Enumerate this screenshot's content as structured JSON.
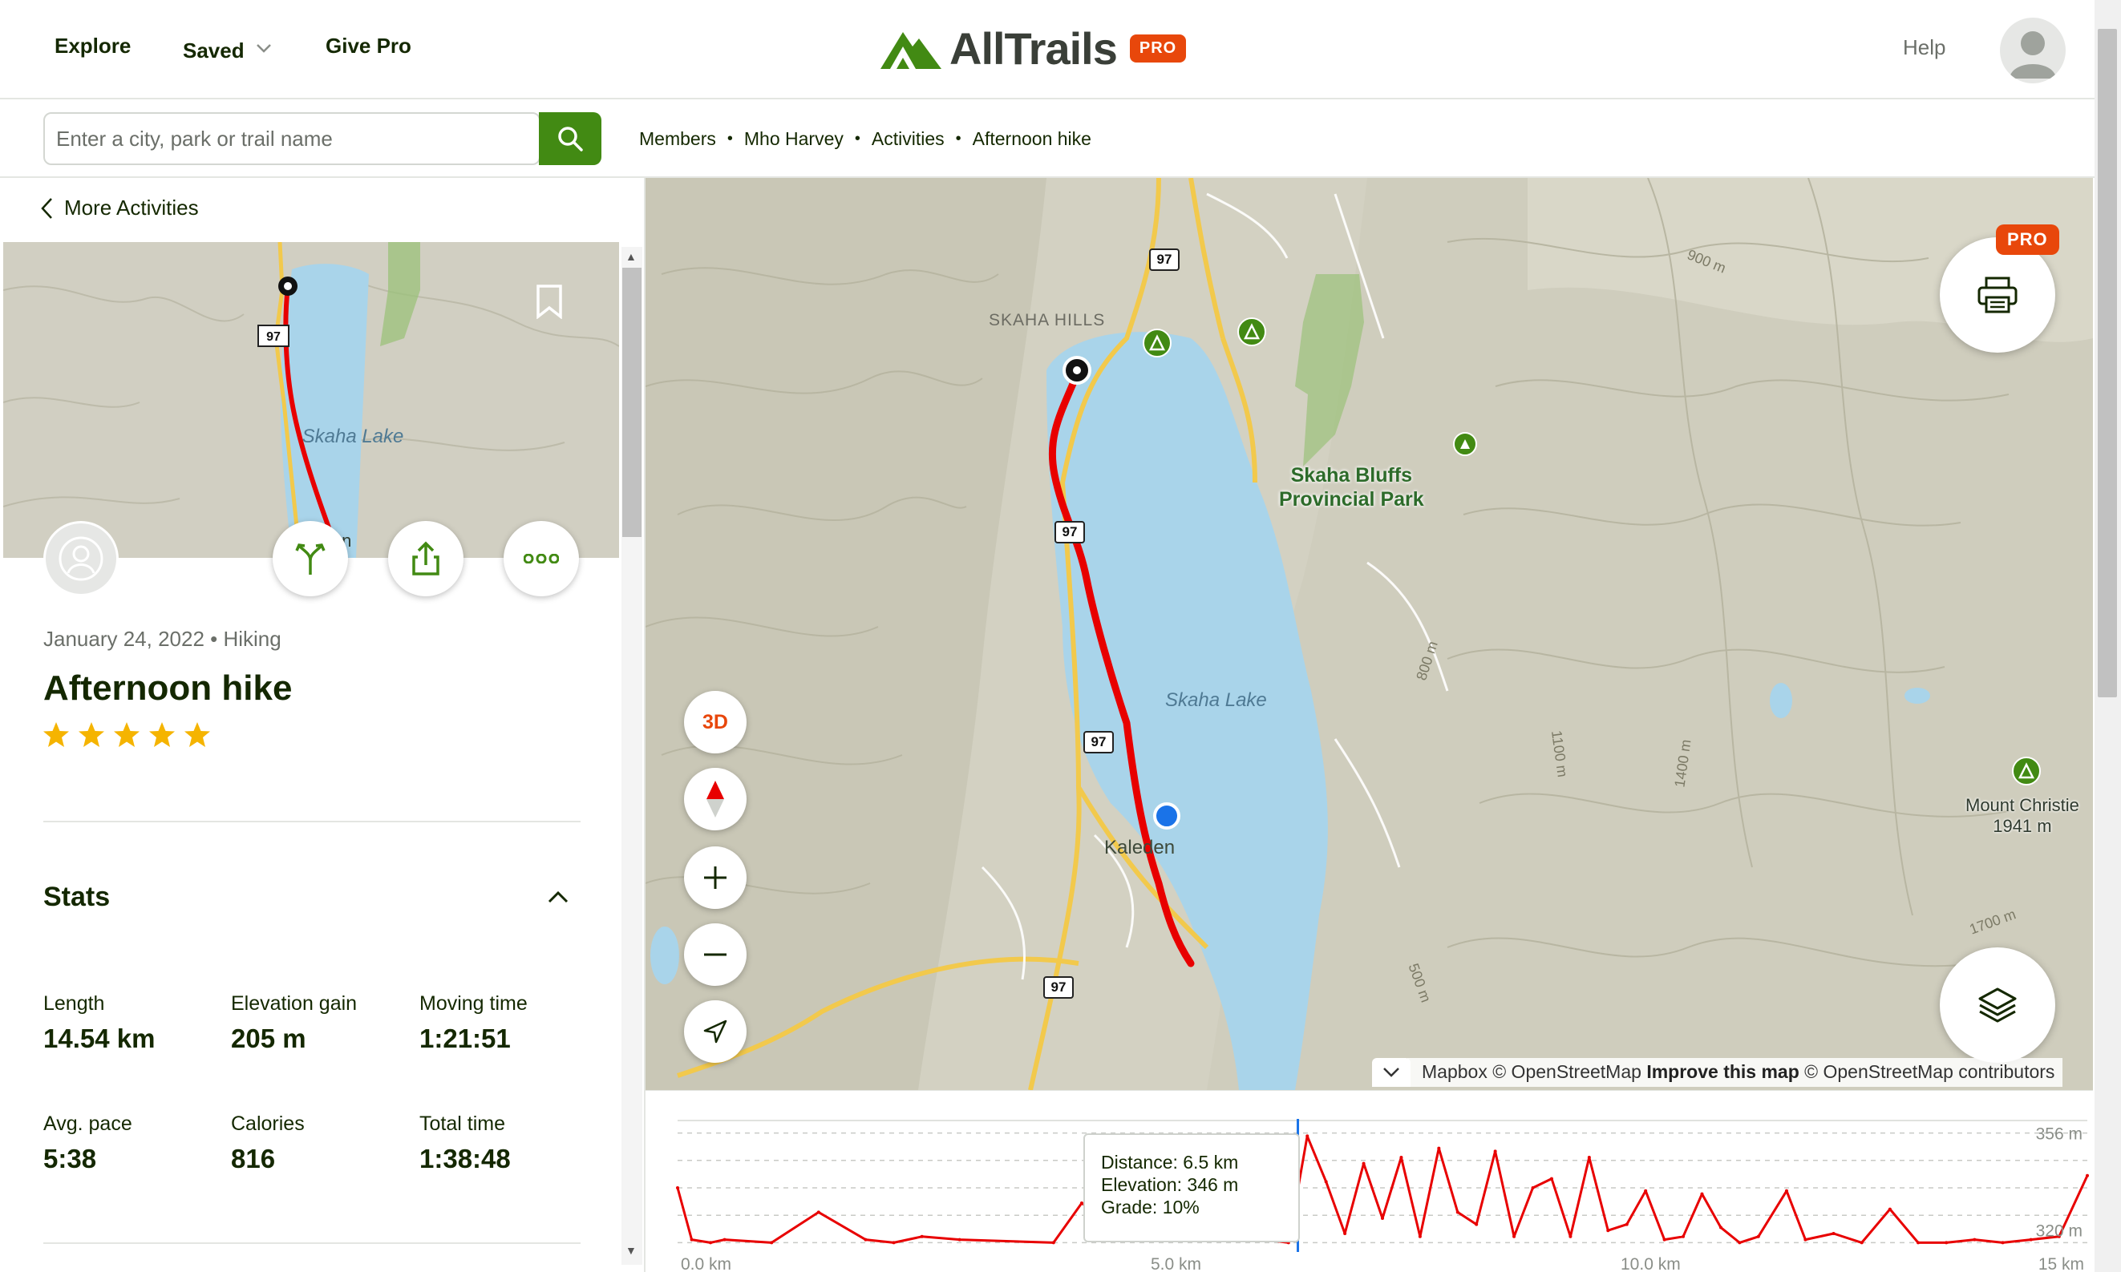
{
  "header": {
    "nav": [
      "Explore",
      "Saved",
      "Give Pro"
    ],
    "logo_text": "AllTrails",
    "logo_badge": "PRO",
    "help": "Help"
  },
  "search": {
    "placeholder": "Enter a city, park or trail name",
    "value": ""
  },
  "breadcrumbs": [
    "Members",
    "Mho Harvey",
    "Activities",
    "Afternoon hike"
  ],
  "sidebar": {
    "back_label": "More Activities",
    "thumbnail": {
      "lake_label": "Skaha Lake",
      "town_label": "Kaleden",
      "highway": "97"
    },
    "meta": "January 24, 2022 • Hiking",
    "title": "Afternoon hike",
    "rating": 5,
    "stats_heading": "Stats",
    "stats": [
      {
        "label": "Length",
        "value": "14.54 km"
      },
      {
        "label": "Elevation gain",
        "value": "205 m"
      },
      {
        "label": "Moving time",
        "value": "1:21:51"
      },
      {
        "label": "Avg. pace",
        "value": "5:38"
      },
      {
        "label": "Calories",
        "value": "816"
      },
      {
        "label": "Total time",
        "value": "1:38:48"
      }
    ]
  },
  "map": {
    "labels": {
      "skaha_hills": "SKAHA HILLS",
      "lake": "Skaha Lake",
      "town": "Kaleden",
      "park_line1": "Skaha Bluffs",
      "park_line2": "Provincial Park",
      "peak_name": "Mount Christie",
      "peak_elev": "1941 m",
      "contours": [
        "900 m",
        "800 m",
        "1100 m",
        "1400 m",
        "500 m",
        "1700 m"
      ],
      "highway": "97"
    },
    "controls": {
      "three_d": "3D",
      "pro_badge": "PRO"
    },
    "attribution": {
      "mapbox": "Mapbox © OpenStreetMap",
      "improve": "Improve this map",
      "osm": "© OpenStreetMap contributors"
    },
    "colors": {
      "route": "#e80000",
      "start_marker": "#111111",
      "current_marker": "#1a73e8",
      "lake": "#a9d4ea",
      "brand_green": "#428a13",
      "pro_orange": "#e8470b"
    }
  },
  "elevation_chart": {
    "tooltip": {
      "distance": "Distance: 6.5 km",
      "elevation": "Elevation: 346 m",
      "grade": "Grade: 10%"
    },
    "x_ticks": [
      "0.0 km",
      "5.0 km",
      "10.0 km",
      "15 km"
    ],
    "y_ticks": [
      "356 m",
      "320 m"
    ]
  },
  "chart_data": {
    "type": "line",
    "title": "",
    "xlabel": "",
    "ylabel": "",
    "x_unit": "km",
    "y_unit": "m",
    "xlim": [
      0,
      15
    ],
    "ylim": [
      318,
      358
    ],
    "grid": true,
    "x": [
      0.0,
      0.15,
      0.35,
      0.5,
      1.0,
      1.5,
      2.0,
      2.3,
      2.6,
      3.0,
      4.0,
      4.3,
      4.8,
      5.0,
      5.3,
      6.0,
      6.5,
      6.7,
      6.9,
      7.1,
      7.3,
      7.5,
      7.7,
      7.9,
      8.1,
      8.3,
      8.5,
      8.7,
      8.9,
      9.1,
      9.3,
      9.5,
      9.7,
      9.9,
      10.1,
      10.3,
      10.5,
      10.7,
      10.9,
      11.1,
      11.3,
      11.5,
      11.8,
      12.0,
      12.3,
      12.6,
      12.9,
      13.2,
      13.5,
      13.8,
      14.1,
      14.4,
      14.7,
      15.0
    ],
    "series": [
      {
        "values": [
          338,
          321,
          320,
          321,
          320,
          330,
          321,
          320,
          322,
          321,
          320,
          333,
          321,
          322,
          321,
          322,
          320,
          355,
          340,
          323,
          346,
          328,
          348,
          322,
          351,
          330,
          326,
          350,
          322,
          338,
          341,
          322,
          348,
          324,
          326,
          337,
          321,
          322,
          336,
          325,
          320,
          322,
          337,
          321,
          323,
          320,
          331,
          320,
          320,
          321,
          320,
          321,
          322,
          342
        ]
      }
    ],
    "cursor_x": 6.5
  }
}
